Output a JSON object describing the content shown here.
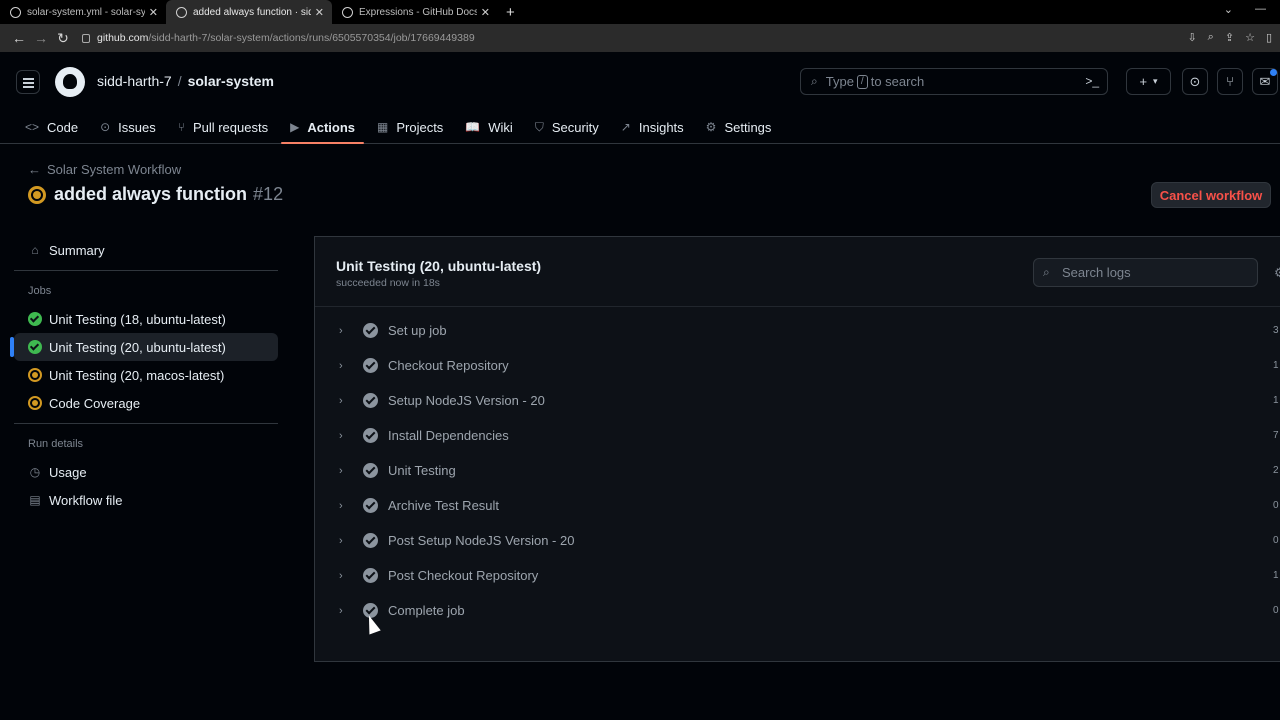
{
  "browser": {
    "tabs": [
      {
        "title": "solar-system.yml - solar-system",
        "active": false
      },
      {
        "title": "added always function · sidd-harth",
        "active": true
      },
      {
        "title": "Expressions - GitHub Docs",
        "active": false
      }
    ],
    "url_host": "github.com",
    "url_path": "/sidd-harth-7/solar-system/actions/runs/6505570354/job/17669449389"
  },
  "header": {
    "owner": "sidd-harth-7",
    "separator": "/",
    "repo": "solar-system",
    "search_placeholder_pre": "Type",
    "search_key": "/",
    "search_placeholder_post": "to search"
  },
  "repo_nav": [
    {
      "label": "Code",
      "icon": "code-icon",
      "glyph": "<>"
    },
    {
      "label": "Issues",
      "icon": "issue-icon",
      "glyph": "⊙"
    },
    {
      "label": "Pull requests",
      "icon": "pull-request-icon",
      "glyph": "⑂"
    },
    {
      "label": "Actions",
      "icon": "play-icon",
      "glyph": "▶"
    },
    {
      "label": "Projects",
      "icon": "table-icon",
      "glyph": "▦"
    },
    {
      "label": "Wiki",
      "icon": "book-icon",
      "glyph": "📖"
    },
    {
      "label": "Security",
      "icon": "shield-icon",
      "glyph": "⛉"
    },
    {
      "label": "Insights",
      "icon": "graph-icon",
      "glyph": "↗"
    },
    {
      "label": "Settings",
      "icon": "gear-icon",
      "glyph": "⚙"
    }
  ],
  "run": {
    "back_label": "Solar System Workflow",
    "title": "added always function",
    "number": "#12",
    "cancel_label": "Cancel workflow"
  },
  "sidebar": {
    "summary": "Summary",
    "jobs_heading": "Jobs",
    "jobs": [
      {
        "label": "Unit Testing (18, ubuntu-latest)",
        "status": "success"
      },
      {
        "label": "Unit Testing (20, ubuntu-latest)",
        "status": "success"
      },
      {
        "label": "Unit Testing (20, macos-latest)",
        "status": "in_progress"
      },
      {
        "label": "Code Coverage",
        "status": "in_progress"
      }
    ],
    "run_details_heading": "Run details",
    "usage": "Usage",
    "workflow_file": "Workflow file"
  },
  "job": {
    "name": "Unit Testing (20, ubuntu-latest)",
    "subtitle": "succeeded now in 18s",
    "search_placeholder": "Search logs",
    "steps": [
      {
        "label": "Set up job",
        "duration": "3"
      },
      {
        "label": "Checkout Repository",
        "duration": "1"
      },
      {
        "label": "Setup NodeJS Version - 20",
        "duration": "1"
      },
      {
        "label": "Install Dependencies",
        "duration": "7"
      },
      {
        "label": "Unit Testing",
        "duration": "2"
      },
      {
        "label": "Archive Test Result",
        "duration": "0"
      },
      {
        "label": "Post Setup NodeJS Version - 20",
        "duration": "0"
      },
      {
        "label": "Post Checkout Repository",
        "duration": "1"
      },
      {
        "label": "Complete job",
        "duration": "0"
      }
    ]
  }
}
